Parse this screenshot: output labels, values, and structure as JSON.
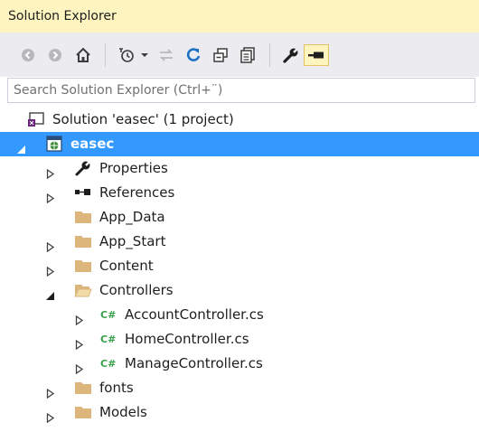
{
  "window": {
    "title": "Solution Explorer"
  },
  "toolbar": {
    "buttons": [
      {
        "name": "back-icon"
      },
      {
        "name": "forward-icon"
      },
      {
        "name": "home-icon"
      },
      {
        "name": "pending-changes-filter-icon"
      },
      {
        "name": "dropdown-arrow-icon"
      },
      {
        "name": "sync-with-active-document-icon"
      },
      {
        "name": "refresh-icon"
      },
      {
        "name": "collapse-all-icon"
      },
      {
        "name": "show-all-files-icon"
      },
      {
        "name": "properties-wrench-icon"
      },
      {
        "name": "pin-icon"
      }
    ],
    "colors": {
      "active_bg": "#fdf4bf",
      "refresh": "#1e72c6"
    }
  },
  "search": {
    "placeholder": "Search Solution Explorer (Ctrl+¨)"
  },
  "tree": {
    "solution": {
      "label": "Solution 'easec' (1 project)",
      "icon": "solution-icon"
    },
    "project": {
      "label": "easec",
      "icon": "web-project-icon",
      "expanded": true,
      "selected": true
    },
    "items": [
      {
        "label": "Properties",
        "icon": "wrench-icon",
        "expandable": true,
        "expanded": false
      },
      {
        "label": "References",
        "icon": "references-icon",
        "expandable": true,
        "expanded": false
      },
      {
        "label": "App_Data",
        "icon": "folder-icon",
        "expandable": false
      },
      {
        "label": "App_Start",
        "icon": "folder-icon",
        "expandable": true,
        "expanded": false
      },
      {
        "label": "Content",
        "icon": "folder-icon",
        "expandable": true,
        "expanded": false
      },
      {
        "label": "Controllers",
        "icon": "folder-open-icon",
        "expandable": true,
        "expanded": true
      },
      {
        "label": "AccountController.cs",
        "icon": "csharp-file-icon",
        "badge": "C#",
        "expandable": true,
        "expanded": false
      },
      {
        "label": "HomeController.cs",
        "icon": "csharp-file-icon",
        "badge": "C#",
        "expandable": true,
        "expanded": false
      },
      {
        "label": "ManageController.cs",
        "icon": "csharp-file-icon",
        "badge": "C#",
        "expandable": true,
        "expanded": false
      },
      {
        "label": "fonts",
        "icon": "folder-icon",
        "expandable": true,
        "expanded": false
      },
      {
        "label": "Models",
        "icon": "folder-icon",
        "expandable": true,
        "expanded": false
      }
    ],
    "colors": {
      "selection": "#3399ff",
      "folder": "#dcb67a",
      "csharp": "#37a14b"
    }
  }
}
